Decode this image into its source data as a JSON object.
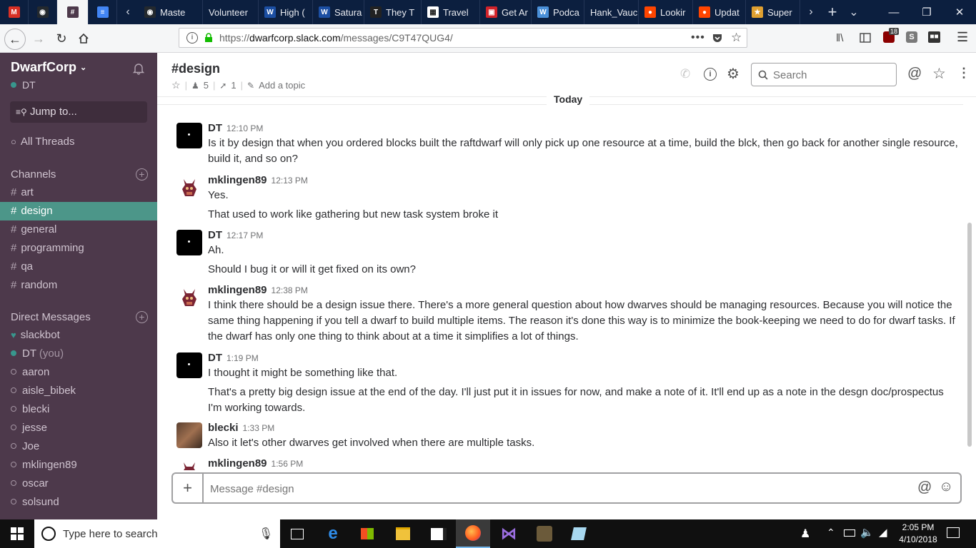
{
  "browser": {
    "tabs": [
      {
        "label": "",
        "icon": "gmail-icon",
        "color": "#d93025",
        "glyph": "M"
      },
      {
        "label": "",
        "icon": "github-icon",
        "color": "#24292e",
        "glyph": "◉"
      },
      {
        "label": "",
        "icon": "slack-icon",
        "color": "#4d394b",
        "glyph": "#",
        "active": true
      },
      {
        "label": "",
        "icon": "docs-icon",
        "color": "#4285f4",
        "glyph": "≡"
      },
      {
        "label": "Maste",
        "icon": "github-icon",
        "color": "#24292e",
        "glyph": "◉"
      },
      {
        "label": "Volunteer",
        "icon": "",
        "color": "",
        "glyph": ""
      },
      {
        "label": "High (",
        "icon": "web-icon",
        "color": "#1c4fa3",
        "glyph": "W"
      },
      {
        "label": "Satura",
        "icon": "web-icon",
        "color": "#1c4fa3",
        "glyph": "W"
      },
      {
        "label": "They T",
        "icon": "verge-icon",
        "color": "#222",
        "glyph": "T"
      },
      {
        "label": "Travel",
        "icon": "travel-icon",
        "color": "#fff",
        "glyph": "▦"
      },
      {
        "label": "Get Ar",
        "icon": "news-icon",
        "color": "#d2232a",
        "glyph": "▣"
      },
      {
        "label": "Podca",
        "icon": "wordpress-icon",
        "color": "#4a90d9",
        "glyph": "W"
      },
      {
        "label": "Hank_Vauc",
        "icon": "",
        "color": "",
        "glyph": ""
      },
      {
        "label": "Lookir",
        "icon": "reddit-icon",
        "color": "#ff4500",
        "glyph": "●"
      },
      {
        "label": "Updat",
        "icon": "reddit-icon",
        "color": "#ff4500",
        "glyph": "●"
      },
      {
        "label": "Super",
        "icon": "game-icon",
        "color": "#e0a030",
        "glyph": "★"
      }
    ],
    "url_prefix": "https://",
    "url_domain": "dwarfcorp.slack.com",
    "url_path": "/messages/C9T47QUG4/",
    "badge_count": "18"
  },
  "sidebar": {
    "workspace": "DwarfCorp",
    "user": "DT",
    "jump_to": "Jump to...",
    "all_threads": "All Threads",
    "channels_heading": "Channels",
    "channels": [
      "art",
      "design",
      "general",
      "programming",
      "qa",
      "random"
    ],
    "dm_heading": "Direct Messages",
    "dms": [
      {
        "name": "slackbot",
        "status": "bot"
      },
      {
        "name": "DT",
        "suffix": "(you)",
        "status": "on"
      },
      {
        "name": "aaron",
        "status": "off"
      },
      {
        "name": "aisle_bibek",
        "status": "off"
      },
      {
        "name": "blecki",
        "status": "off"
      },
      {
        "name": "jesse",
        "status": "off"
      },
      {
        "name": "Joe",
        "status": "off"
      },
      {
        "name": "mklingen89",
        "status": "off"
      },
      {
        "name": "oscar",
        "status": "off"
      },
      {
        "name": "solsund",
        "status": "off"
      }
    ]
  },
  "channel": {
    "name": "#design",
    "members": "5",
    "pins": "1",
    "add_topic": "Add a topic",
    "search_placeholder": "Search",
    "date_divider": "Today"
  },
  "messages": [
    {
      "author": "DT",
      "time": "12:10 PM",
      "avatar": "dt",
      "lines": [
        "Is it by design that when you ordered blocks built the  raftdwarf will only pick up one resource at a time, build the blck, then go back for another single resource, build it, and so on?"
      ]
    },
    {
      "author": "mklingen89",
      "time": "12:13 PM",
      "avatar": "mk",
      "lines": [
        "Yes.",
        "That used to work like gathering but new task system broke it"
      ]
    },
    {
      "author": "DT",
      "time": "12:17 PM",
      "avatar": "dt",
      "lines": [
        "Ah.",
        "Should I bug it or will it get fixed on its own?"
      ]
    },
    {
      "author": "mklingen89",
      "time": "12:38 PM",
      "avatar": "mk",
      "lines": [
        "I think there should be a design issue there. There's a more general question about how dwarves should be managing resources. Because you will notice the same thing happening if you tell a dwarf to build multiple items. The reason it's done this way is to minimize the book-keeping we need to do for dwarf tasks. If the dwarf has only one thing to think about at a time it simplifies a lot of things."
      ]
    },
    {
      "author": "DT",
      "time": "1:19 PM",
      "avatar": "dt",
      "lines": [
        "I thought it might be something like that.",
        "That's a pretty big design issue at the end of the day. I'll just put it in issues for now, and make a note of it. It'll end up as a note in the desgn doc/prospectus I'm working towards."
      ]
    },
    {
      "author": "blecki",
      "time": "1:33 PM",
      "avatar": "bl",
      "lines": [
        "Also it let's other dwarves get involved when there are multiple tasks."
      ]
    },
    {
      "author": "mklingen89",
      "time": "1:56 PM",
      "avatar": "mk",
      "lines": []
    }
  ],
  "composer": {
    "placeholder": "Message #design"
  },
  "taskbar": {
    "search_placeholder": "Type here to search",
    "time": "2:05 PM",
    "date": "4/10/2018"
  }
}
